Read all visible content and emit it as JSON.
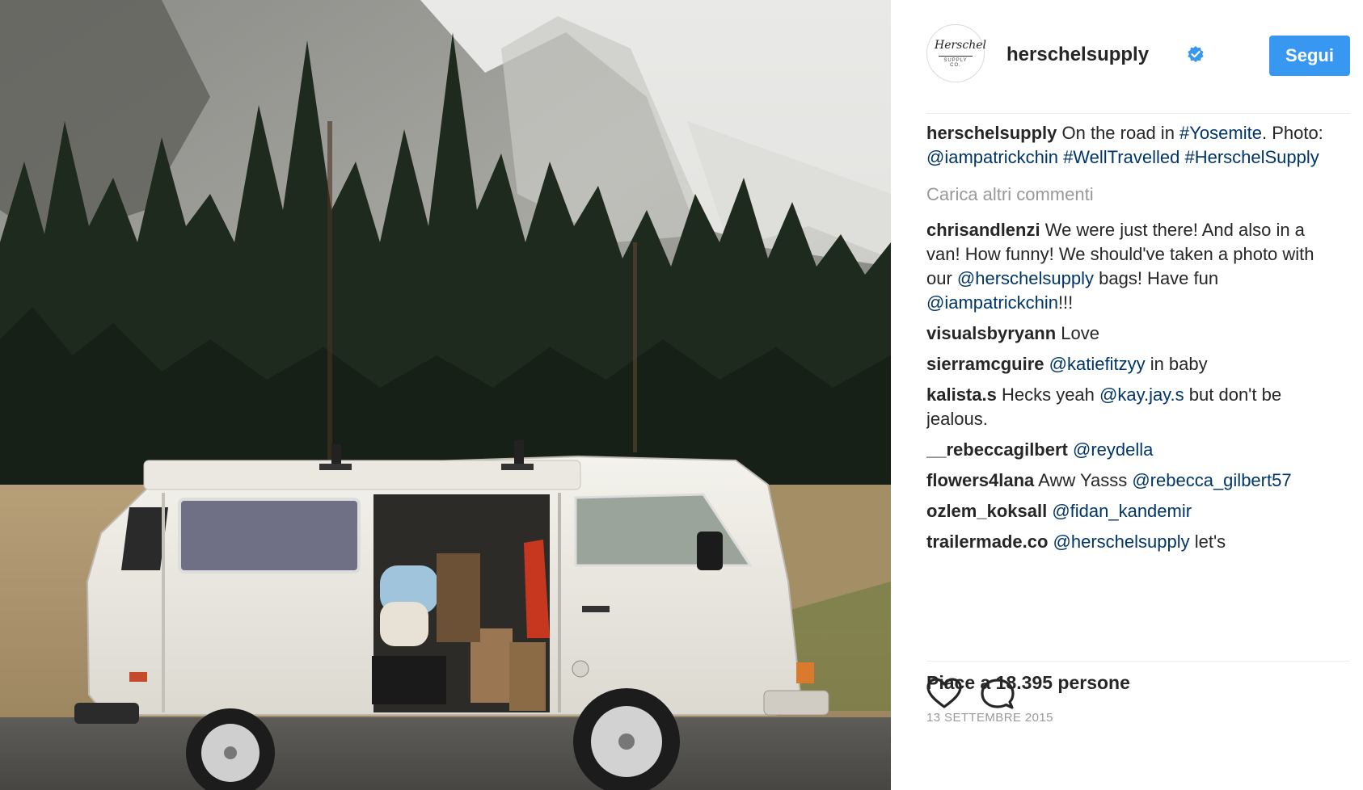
{
  "post": {
    "username": "herschelsupply",
    "follow_label": "Segui",
    "avatar_logo": "Herschel",
    "avatar_logo_sub": "SUPPLY CO.",
    "caption": {
      "user": "herschelsupply",
      "text_1": " On the road in ",
      "tag_1": "#Yosemite",
      "text_2": ". Photo: ",
      "mention_1": "@iampatrickchin",
      "text_3": " ",
      "tag_2": "#WellTravelled",
      "text_4": " ",
      "tag_3": "#HerschelSupply"
    },
    "load_more": "Carica altri commenti",
    "comments": [
      {
        "user": "chrisandlenzi",
        "t1": " We were just there! And also in a van! How funny! We should've taken a photo with our ",
        "m1": "@herschelsupply",
        "t2": " bags! Have fun ",
        "m2": "@iampatrickchin",
        "t3": "!!!"
      },
      {
        "user": "visualsbyryann",
        "t1": " Love"
      },
      {
        "user": "sierramcguire",
        "t1": " ",
        "m1": "@katiefitzyy",
        "t2": " in baby"
      },
      {
        "user": "kalista.s",
        "t1": " Hecks yeah ",
        "m1": "@kay.jay.s",
        "t2": " but don't be jealous."
      },
      {
        "user": "__rebeccagilbert",
        "t1": " ",
        "m1": "@reydella"
      },
      {
        "user": "flowers4lana",
        "t1": " Aww Yasss ",
        "m1": "@rebecca_gilbert57"
      },
      {
        "user": "ozlem_koksall",
        "t1": " ",
        "m1": "@fidan_kandemir"
      },
      {
        "user": "trailermade.co",
        "t1": " ",
        "m1": "@herschelsupply",
        "t2": " let's"
      }
    ],
    "likes": "Piace a 18.395 persone",
    "date": "13 SETTEMBRE 2015"
  },
  "icons": {
    "like": "heart-icon",
    "comment": "comment-bubble-icon",
    "verified": "verified-badge-icon"
  },
  "colors": {
    "follow_button": "#3897f0",
    "link": "#003569",
    "verified": "#3897f0",
    "muted": "#999999"
  }
}
